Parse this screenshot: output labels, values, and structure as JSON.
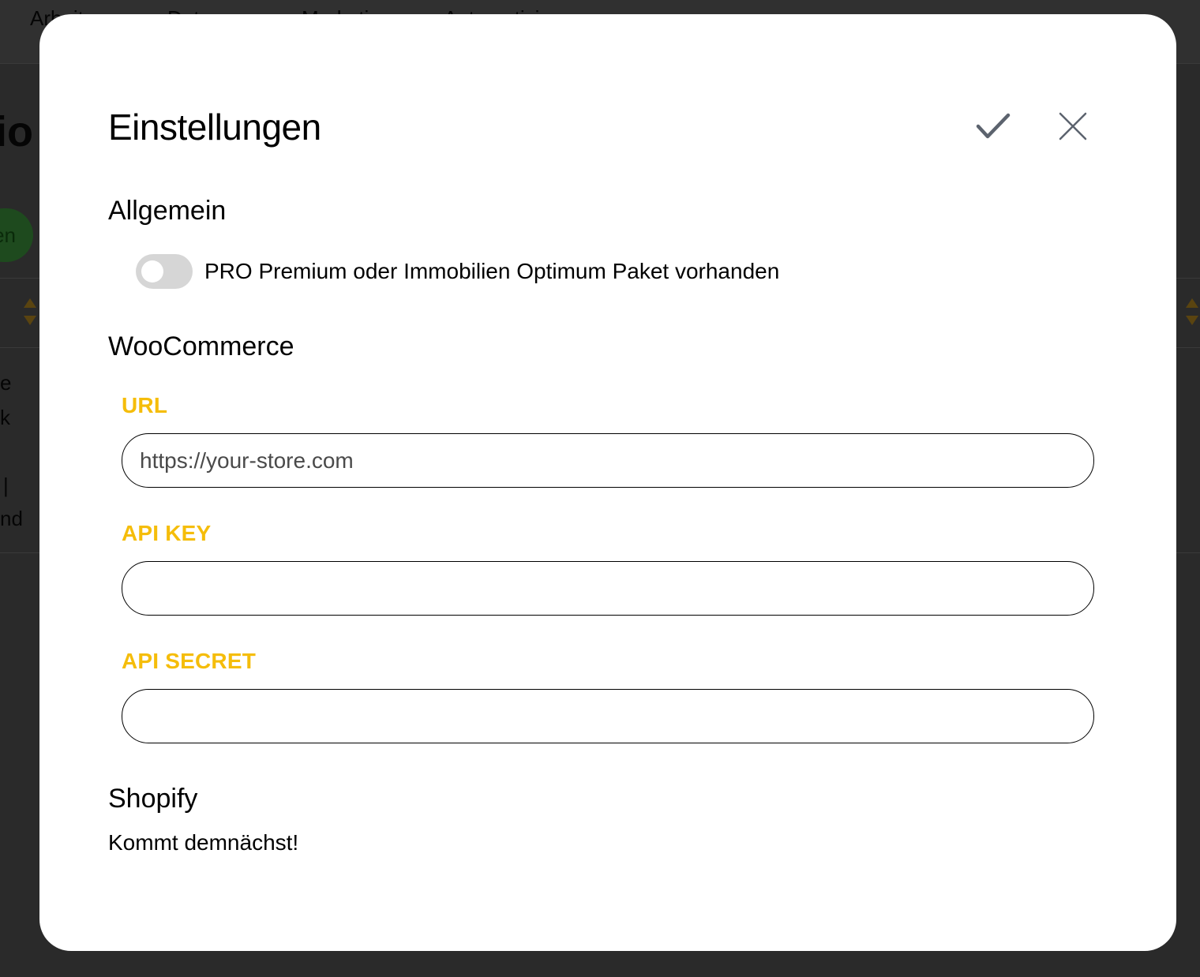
{
  "background": {
    "nav_items": [
      "Arbeit",
      "Daten",
      "Marketing",
      "Automatisierung"
    ],
    "title_fragment": "io",
    "green_button_fragment": "en",
    "text_fragments": [
      "e",
      "k",
      "|",
      "nd"
    ]
  },
  "modal": {
    "title": "Einstellungen",
    "confirm_icon": "check-icon",
    "close_icon": "close-icon",
    "sections": {
      "general": {
        "heading": "Allgemein",
        "toggle_label": "PRO Premium oder Immobilien Optimum Paket vorhanden",
        "toggle_on": false
      },
      "woocommerce": {
        "heading": "WooCommerce",
        "url_label": "URL",
        "url_placeholder": "https://your-store.com",
        "url_value": "",
        "api_key_label": "API KEY",
        "api_key_value": "",
        "api_secret_label": "API SECRET",
        "api_secret_value": ""
      },
      "shopify": {
        "heading": "Shopify",
        "text": "Kommt demnächst!"
      }
    }
  },
  "colors": {
    "accent_label": "#f5bd0a",
    "toggle_off": "#d6d6d6",
    "icon_gray": "#5c636e",
    "overlay": "#262626"
  }
}
